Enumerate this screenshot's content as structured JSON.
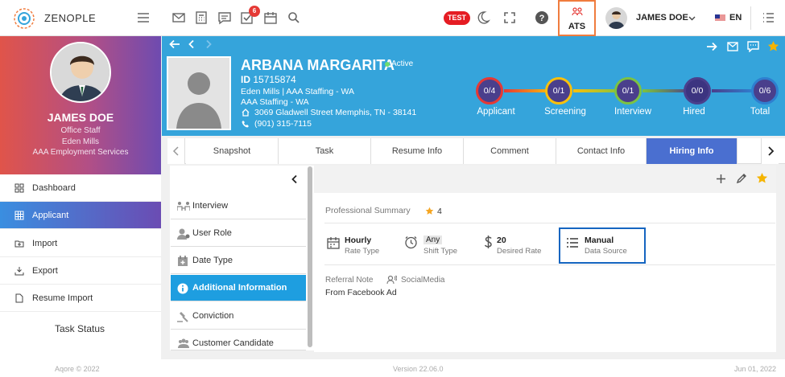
{
  "app": {
    "logo_text": "ZENOPLE"
  },
  "topbar": {
    "task_badge_count": "6",
    "env_badge": "TEST",
    "ats_label": "ATS",
    "user_name": "JAMES DOE",
    "language": "EN"
  },
  "profile": {
    "name": "JAMES DOE",
    "role": "Office Staff",
    "location": "Eden Mills",
    "company": "AAA Employment Services"
  },
  "sidebar": {
    "items": [
      {
        "label": "Dashboard"
      },
      {
        "label": "Applicant"
      },
      {
        "label": "Import"
      },
      {
        "label": "Export"
      },
      {
        "label": "Resume Import"
      }
    ],
    "task_status": "Task Status"
  },
  "candidate": {
    "name": "ARBANA MARGARITA",
    "status": "Active",
    "id_label": "ID",
    "id_value": "15715874",
    "line1": "Eden Mills | AAA Staffing - WA",
    "line2": "AAA Staffing - WA",
    "address": "3069 Gladwell Street Memphis, TN - 38141",
    "phone": "(901) 315-7115"
  },
  "pipeline": [
    {
      "label": "Applicant",
      "count": "0/4",
      "color": "#e53935"
    },
    {
      "label": "Screening",
      "count": "0/1",
      "color": "#f9c00c"
    },
    {
      "label": "Interview",
      "count": "0/1",
      "color": "#7cc242"
    },
    {
      "label": "Hired",
      "count": "0/0",
      "color": "#4a3f8c"
    },
    {
      "label": "Total",
      "count": "0/6",
      "color": "#2e7fd0"
    }
  ],
  "tabs": [
    {
      "label": "Snapshot"
    },
    {
      "label": "Task"
    },
    {
      "label": "Resume Info"
    },
    {
      "label": "Comment"
    },
    {
      "label": "Contact Info"
    },
    {
      "label": "Hiring Info"
    }
  ],
  "inner_menu": [
    {
      "label": "Interview"
    },
    {
      "label": "User Role"
    },
    {
      "label": "Date Type"
    },
    {
      "label": "Additional Information"
    },
    {
      "label": "Conviction"
    },
    {
      "label": "Customer Candidate"
    }
  ],
  "hiring": {
    "professional_summary_label": "Professional Summary",
    "rating": "4",
    "fields": [
      {
        "value": "Hourly",
        "label": "Rate Type"
      },
      {
        "value": "Any",
        "label": "Shift Type"
      },
      {
        "value": "20",
        "label": "Desired Rate"
      },
      {
        "value": "Manual",
        "label": "Data Source"
      }
    ],
    "referral_label": "Referral Note",
    "referral_source": "SocialMedia",
    "referral_value": "From Facebook Ad"
  },
  "footer": {
    "copyright": "Aqore © 2022",
    "version": "Version 22.06.0",
    "date": "Jun 01, 2022"
  },
  "colors": {
    "accent": "#35a4db",
    "active_tab": "#4a6fd0",
    "highlight_box": "#1565c0",
    "ats_border": "#f07c3e"
  }
}
